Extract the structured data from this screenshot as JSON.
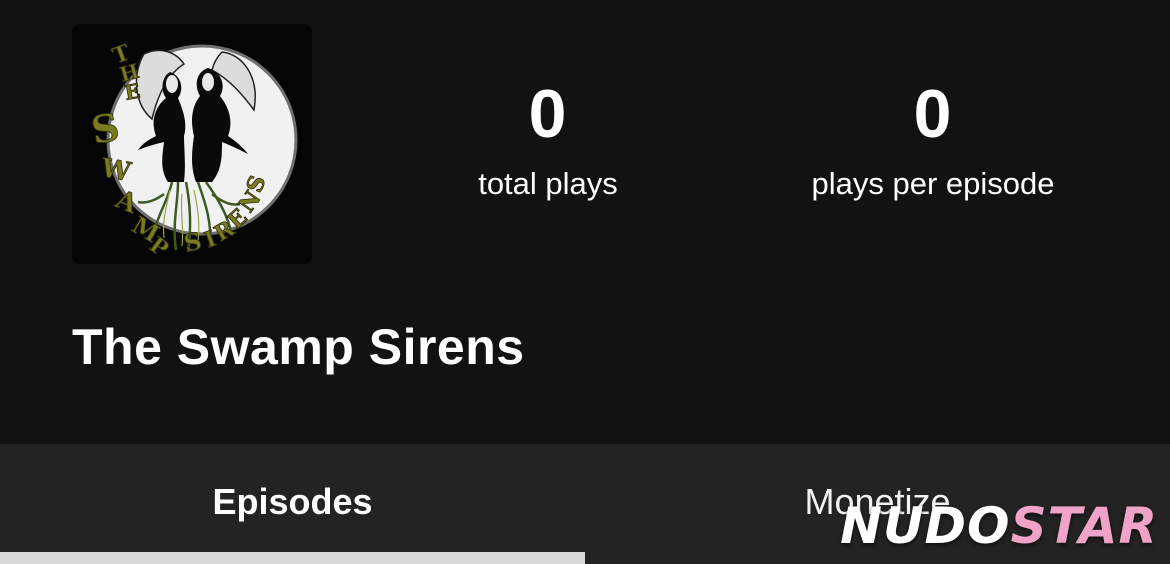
{
  "show": {
    "title": "The Swamp Sirens",
    "cover": {
      "lettering": "THE SWAMP SIRENS",
      "colors": {
        "background": "#050505",
        "moon": "#f1f1f1",
        "lettering": "#7a7a1e"
      }
    }
  },
  "stats": {
    "total_plays": {
      "value": "0",
      "label": "total plays"
    },
    "plays_per_episode": {
      "value": "0",
      "label": "plays per episode"
    }
  },
  "tabs": [
    {
      "label": "Episodes",
      "active": true
    },
    {
      "label": "Monetize",
      "active": false
    }
  ],
  "watermark": {
    "part1": "NUDO",
    "part2": "STAR"
  },
  "colors": {
    "background": "#121212",
    "tabbar": "#232323",
    "indicator": "#d9d9d9",
    "watermark_accent": "#f0a3c8"
  }
}
